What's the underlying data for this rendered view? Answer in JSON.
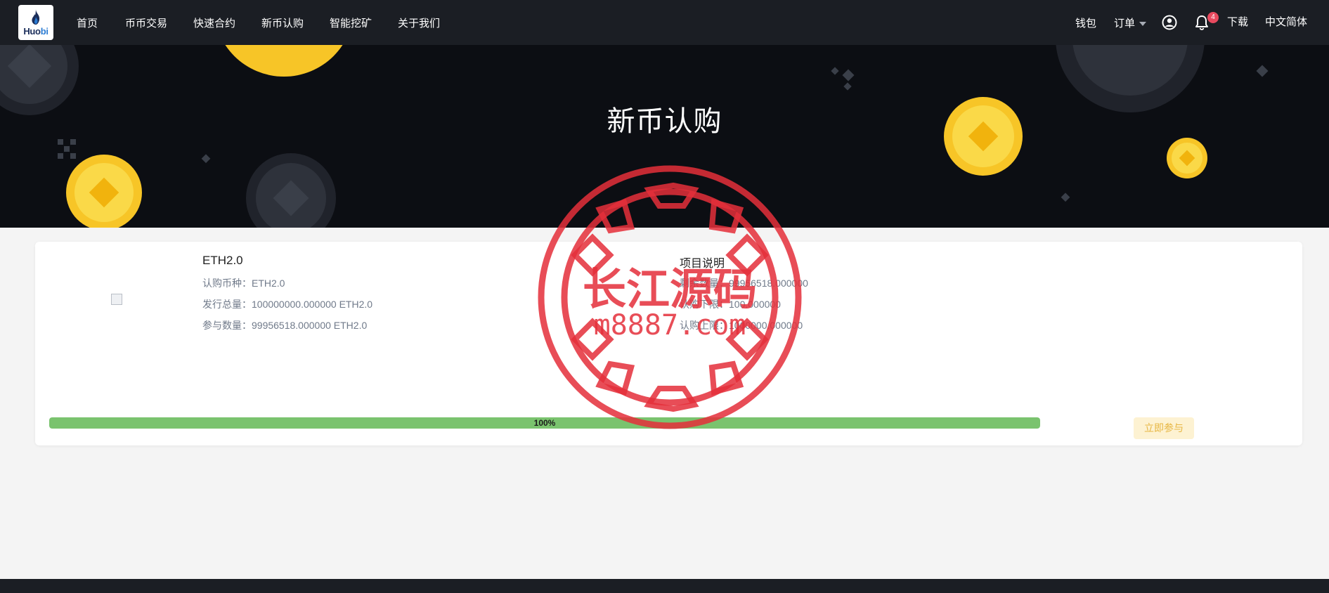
{
  "header": {
    "logo": {
      "brand": "Huo",
      "brand_accent": "bi"
    },
    "nav": [
      {
        "label": "首页"
      },
      {
        "label": "币币交易"
      },
      {
        "label": "快速合约"
      },
      {
        "label": "新币认购"
      },
      {
        "label": "智能挖矿"
      },
      {
        "label": "关于我们"
      }
    ],
    "wallet_label": "钱包",
    "orders_label": "订单",
    "notification_count": "4",
    "download_label": "下载",
    "language_label": "中文简体"
  },
  "hero": {
    "title": "新币认购"
  },
  "project": {
    "name": "ETH2.0",
    "details": [
      {
        "label": "认购币种：",
        "value": "ETH2.0"
      },
      {
        "label": "发行总量：",
        "value": "100000000.000000 ETH2.0"
      },
      {
        "label": "参与数量：",
        "value": "99956518.000000 ETH2.0"
      }
    ],
    "description_title": "项目说明",
    "description_lines": [
      {
        "label": "剩余数量：",
        "value": "99956518.000000"
      },
      {
        "label": "认购下限：",
        "value": "100.000000"
      },
      {
        "label": "认购上限：",
        "value": "1000000.000000"
      }
    ],
    "progress_percent": 100,
    "progress_label": "100%",
    "join_label": "立即参与"
  },
  "watermark": {
    "title": "长江源码",
    "url": "m8887.com"
  },
  "colors": {
    "nav_bg": "#1b1e24",
    "hero_bg": "#0c0e13",
    "progress": "#7ac36e",
    "join_button_bg": "#fdf2d2",
    "join_button_text": "#e7b642",
    "badge": "#e84a5f",
    "coin_gold": "#f7c527",
    "stamp_red": "#e52f3a"
  }
}
